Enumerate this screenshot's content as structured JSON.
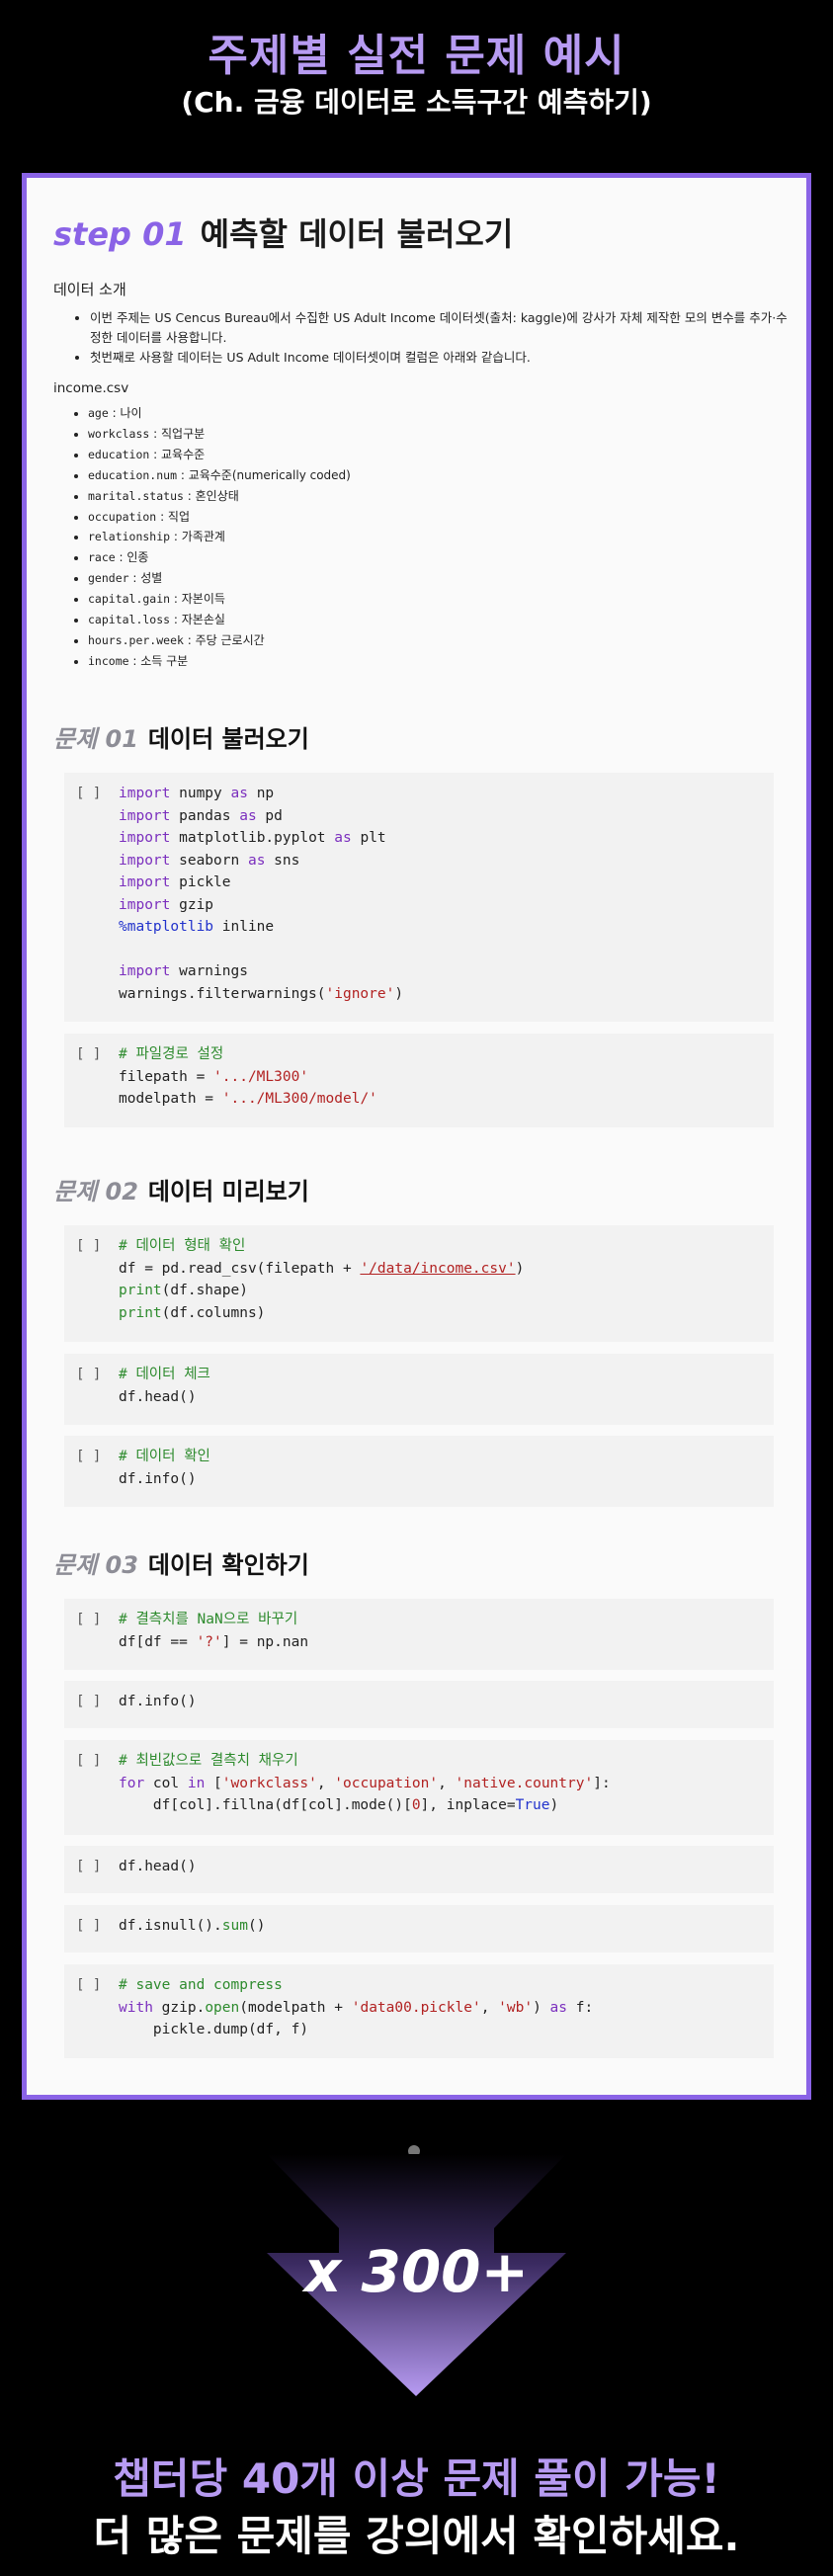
{
  "header": {
    "title": "주제별 실전 문제 예시",
    "subtitle": "(Ch. 금융 데이터로 소득구간 예측하기)"
  },
  "step": {
    "label": "step 01",
    "title": "예측할 데이터 불러오기"
  },
  "intro": {
    "heading": "데이터 소개",
    "bullets": [
      "이번 주제는 US Cencus Bureau에서 수집한 US Adult Income 데이터셋(출처: kaggle)에 강사가 자체 제작한 모의 변수를 추가·수정한 데이터를 사용합니다.",
      "첫번째로 사용할 데이터는 US Adult Income 데이터셋이며 컬럼은 아래와 같습니다."
    ],
    "filename": "income.csv",
    "variables": [
      {
        "name": "age",
        "desc": " : 나이"
      },
      {
        "name": "workclass",
        "desc": " : 직업구분"
      },
      {
        "name": "education",
        "desc": " : 교육수준"
      },
      {
        "name": "education.num",
        "desc": " : 교육수준(numerically coded)"
      },
      {
        "name": "marital.status",
        "desc": " : 혼인상태"
      },
      {
        "name": "occupation",
        "desc": " : 직업"
      },
      {
        "name": "relationship",
        "desc": " : 가족관계"
      },
      {
        "name": "race",
        "desc": " : 인종"
      },
      {
        "name": "gender",
        "desc": " : 성별"
      },
      {
        "name": "capital.gain",
        "desc": " : 자본이득"
      },
      {
        "name": "capital.loss",
        "desc": " : 자본손실"
      },
      {
        "name": "hours.per.week",
        "desc": " : 주당 근로시간"
      },
      {
        "name": "income",
        "desc": " : 소득 구분"
      }
    ]
  },
  "problems": [
    {
      "num": "문제 01",
      "title": "데이터 불러오기"
    },
    {
      "num": "문제 02",
      "title": "데이터 미리보기"
    },
    {
      "num": "문제 03",
      "title": "데이터 확인하기"
    }
  ],
  "cell_bracket": "[ ]",
  "cells": [
    "<span class=\"kw\">import</span> numpy <span class=\"kw\">as</span> np\n<span class=\"kw\">import</span> pandas <span class=\"kw\">as</span> pd\n<span class=\"kw\">import</span> matplotlib.pyplot <span class=\"kw\">as</span> plt\n<span class=\"kw\">import</span> seaborn <span class=\"kw\">as</span> sns\n<span class=\"kw\">import</span> pickle\n<span class=\"kw\">import</span> gzip\n<span class=\"mg\">%matplotlib</span> inline\n\n<span class=\"kw\">import</span> warnings\nwarnings.filterwarnings(<span class=\"st\">'ignore'</span>)",
    "<span class=\"cm\"># 파일경로 설정</span>\nfilepath = <span class=\"st\">'.../ML300'</span>\nmodelpath = <span class=\"st\">'.../ML300/model/'</span>",
    "<span class=\"cm\"># 데이터 형태 확인</span>\ndf = pd.read_csv(filepath + <span class=\"st\" style=\"text-decoration:underline\">'/data/income.csv'</span>)\n<span class=\"bi\">print</span>(df.shape)\n<span class=\"bi\">print</span>(df.columns)",
    "<span class=\"cm\"># 데이터 체크</span>\ndf.head()",
    "<span class=\"cm\"># 데이터 확인</span>\ndf.info()",
    "<span class=\"cm\"># 결측치를 NaN으로 바꾸기</span>\ndf[df == <span class=\"st\">'?'</span>] = np.nan",
    "df.info()",
    "<span class=\"cm\"># 최빈값으로 결측치 채우기</span>\n<span class=\"kw\">for</span> col <span class=\"kw\">in</span> [<span class=\"st\">'workclass'</span>, <span class=\"st\">'occupation'</span>, <span class=\"st\">'native.country'</span>]:\n    df[col].fillna(df[col].mode()[<span class=\"st\">0</span>], inplace=<span class=\"mg\">True</span>)",
    "df.head()",
    "df.isnull().<span class=\"bi\">sum</span>()",
    "<span class=\"cm\"># save and compress</span>\n<span class=\"kw\">with</span> gzip.<span class=\"bi\">open</span>(modelpath + <span class=\"st\">'data00.pickle'</span>, <span class=\"st\">'wb'</span>) <span class=\"kw\">as</span> f:\n    pickle.dump(df, f)"
  ],
  "promo": {
    "multiplier": "x 300+",
    "line1": "챕터당 40개 이상 문제 풀이 가능!",
    "line2": "더 많은 문제를 강의에서 확인하세요."
  },
  "colors": {
    "accent": "#8a63e6",
    "accent_light": "#b79bf2",
    "background": "#000000",
    "card": "#fafafa",
    "cell": "#f2f2f2"
  }
}
